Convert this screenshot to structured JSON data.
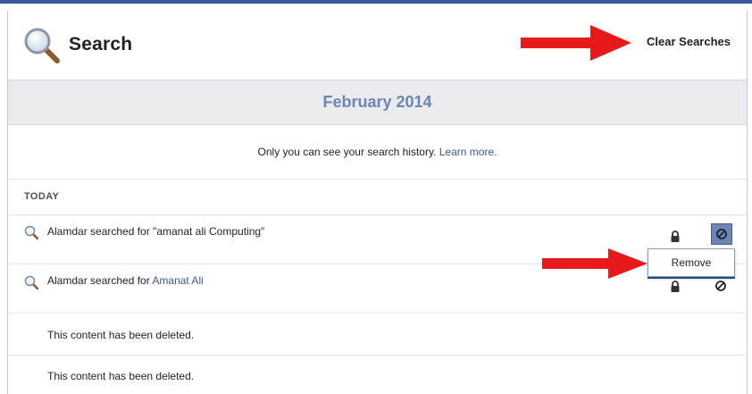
{
  "header": {
    "title": "Search",
    "clear_label": "Clear Searches"
  },
  "month": {
    "label": "February 2014"
  },
  "notice": {
    "text": "Only you can see your search history. ",
    "link": "Learn more."
  },
  "section": {
    "heading": "TODAY"
  },
  "rows": [
    {
      "prefix": "Alamdar searched for \"amanat ali Computing\"",
      "link": ""
    },
    {
      "prefix": "Alamdar searched for ",
      "link": "Amanat Ali"
    },
    {
      "text": "This content has been deleted."
    },
    {
      "text": "This content has been deleted."
    }
  ],
  "menu": {
    "remove_label": "Remove"
  },
  "colors": {
    "brand": "#3b5998",
    "month_text": "#6d84b4",
    "arrow": "#e8191b",
    "active_button": "#6d84b4"
  },
  "icons": {
    "header": "magnifier-icon",
    "row": "search-icon",
    "privacy": "lock-icon",
    "action": "block-icon"
  }
}
